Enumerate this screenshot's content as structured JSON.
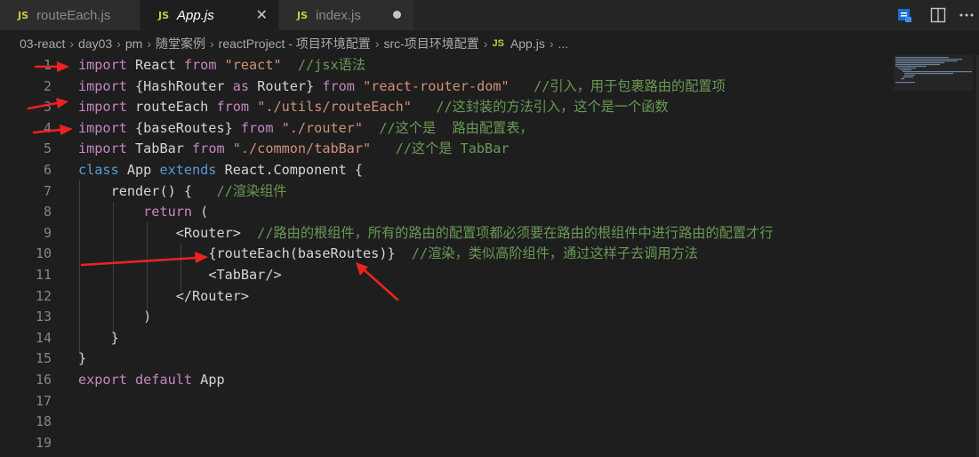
{
  "tabs": [
    {
      "icon": "JS",
      "label": "routeEach.js"
    },
    {
      "icon": "JS",
      "label": "App.js",
      "close": "✕"
    },
    {
      "icon": "JS",
      "label": "index.js"
    }
  ],
  "breadcrumb": {
    "items": [
      "03-react",
      "day03",
      "pm",
      "随堂案例",
      "reactProject - 项目环境配置",
      "src-项目环境配置"
    ],
    "file_icon": "JS",
    "file": "App.js",
    "ellipsis": "..."
  },
  "line_numbers": [
    "1",
    "2",
    "3",
    "4",
    "5",
    "6",
    "7",
    "8",
    "9",
    "10",
    "11",
    "12",
    "13",
    "14",
    "15",
    "16",
    "17",
    "18",
    "19"
  ],
  "code": {
    "l1": {
      "kw": "import",
      "name": " React ",
      "from": "from",
      "str": " \"react\"",
      "comment": "  //jsx语法"
    },
    "l2": {
      "kw": "import",
      "p1": " {HashRouter ",
      "as": "as",
      "p2": " Router} ",
      "from": "from",
      "str": " \"react-router-dom\"",
      "comment": "   //引入，用于包裹路由的配置项"
    },
    "l3": {
      "kw": "import",
      "name": " routeEach ",
      "from": "from",
      "str": " \"./utils/routeEach\"",
      "comment": "   //这封装的方法引入，这个是一个函数"
    },
    "l4": {
      "kw": "import",
      "name": " {baseRoutes} ",
      "from": "from",
      "str": " \"./router\"",
      "comment": "  //这个是  路由配置表，"
    },
    "l5": {
      "kw": "import",
      "name": " TabBar ",
      "from": "from",
      "str": " \"./common/tabBar\"",
      "comment": "   //这个是 TabBar"
    },
    "l6": {
      "kw": "class",
      "name": " App ",
      "ext": "extends",
      "base": " React.Component {"
    },
    "l7": {
      "indent": "    ",
      "fn": "render",
      "rest": "() {",
      "comment": "   //渲染组件"
    },
    "l8": {
      "indent": "        ",
      "kw": "return",
      "rest": " ("
    },
    "l9": {
      "indent": "            ",
      "tag": "<Router>",
      "comment": "  //路由的根组件，所有的路由的配置项都必须要在路由的根组件中进行路由的配置才行"
    },
    "l10": {
      "indent": "                ",
      "expr": "{routeEach(baseRoutes)}",
      "comment": "  //渲染，类似高阶组件，通过这样子去调用方法"
    },
    "l11": {
      "indent": "                ",
      "tag": "<TabBar/>"
    },
    "l12": {
      "indent": "            ",
      "tag": "</Router>"
    },
    "l13": {
      "indent": "        ",
      "rest": ")"
    },
    "l14": {
      "indent": "    ",
      "rest": "}"
    },
    "l15": {
      "rest": "}"
    },
    "l16": {
      "kw": "export",
      "kw2": " default",
      "rest": " App"
    }
  },
  "colors": {
    "keyword": "#569cd6",
    "control_keyword": "#c586c0",
    "string": "#ce9178",
    "comment": "#6a9955",
    "annotation_arrow": "#ee2222"
  },
  "icons": [
    "split-editor-icon",
    "preview-icon",
    "more-actions-icon",
    "chevron-right-icon",
    "annotation-arrow"
  ]
}
